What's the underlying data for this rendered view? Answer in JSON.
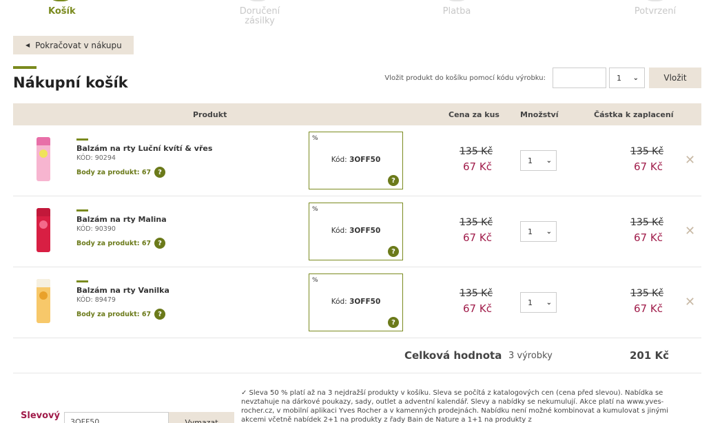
{
  "steps": [
    {
      "label": "Košík",
      "active": true
    },
    {
      "label": "Doručení zásilky",
      "active": false
    },
    {
      "label": "Platba",
      "active": false
    },
    {
      "label": "Potvrzení",
      "active": false
    }
  ],
  "back_button": "Pokračovat v nákupu",
  "page_title": "Nákupní košík",
  "code_entry": {
    "label": "Vložit produkt do košíku pomocí kódu výrobku:",
    "qty": "1",
    "button": "Vložit"
  },
  "table_head": {
    "product": "Produkt",
    "unit_price": "Cena za kus",
    "quantity": "Množství",
    "total": "Částka k zaplacení"
  },
  "items": [
    {
      "name": "Balzám na rty Luční kvítí & vřes",
      "code": "KÓD: 90294",
      "points": "Body za produkt: 67",
      "promo_pct": "%",
      "promo_prefix": "Kód: ",
      "promo_code": "3OFF50",
      "old_price": "135 Kč",
      "new_price": "67 Kč",
      "qty": "1",
      "old_total": "135 Kč",
      "new_total": "67 Kč",
      "color": "#e86fa8",
      "cap": "#f4f4f4"
    },
    {
      "name": "Balzám na rty Malina",
      "code": "KÓD: 90390",
      "points": "Body za produkt: 67",
      "promo_pct": "%",
      "promo_prefix": "Kód: ",
      "promo_code": "3OFF50",
      "old_price": "135 Kč",
      "new_price": "67 Kč",
      "qty": "1",
      "old_total": "135 Kč",
      "new_total": "67 Kč",
      "color": "#d81f43",
      "cap": "#c2183a"
    },
    {
      "name": "Balzám na rty Vanilka",
      "code": "KÓD: 89479",
      "points": "Body za produkt: 67",
      "promo_pct": "%",
      "promo_prefix": "Kód: ",
      "promo_code": "3OFF50",
      "old_price": "135 Kč",
      "new_price": "67 Kč",
      "qty": "1",
      "old_total": "135 Kč",
      "new_total": "67 Kč",
      "color": "#f3b13a",
      "cap": "#f6f0e0"
    }
  ],
  "total": {
    "label": "Celková hodnota",
    "count": "3 výrobky",
    "value": "201 Kč"
  },
  "discount": {
    "label": "Slevový",
    "value": "3OFF50",
    "button": "Vymazat"
  },
  "note": "✓ Sleva 50 % platí až na 3 nejdražší produkty v košíku. Sleva se počítá z katalogových cen (cena před slevou). Nabídka se nevztahuje na dárkové poukazy, sady, outlet a adventní kalendář. Slevy a nabídky se nekumulují. Akce platí na www.yves-rocher.cz, v mobilní aplikaci Yves Rocher a v kamenných prodejnách. Nabídku není možné kombinovat a kumulovat s jinými akcemi včetně nabídek 2+1 na produkty z řady Bain de Nature a 1+1 na produkty z"
}
